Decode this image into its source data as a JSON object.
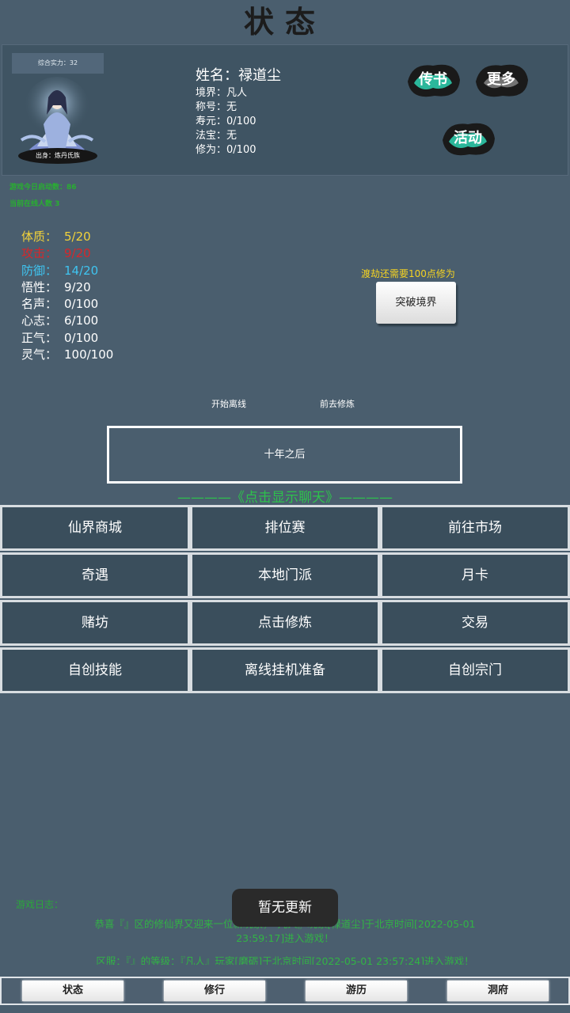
{
  "header": {
    "title": "状态"
  },
  "profile": {
    "power": "综合实力：32",
    "origin": "出身：炼丹氏族",
    "name_label": "姓名：",
    "name": "禄道尘",
    "rows": [
      {
        "label": "境界：",
        "value": "凡人"
      },
      {
        "label": "称号：",
        "value": "无"
      },
      {
        "label": "寿元：",
        "value": "0/100"
      },
      {
        "label": "法宝：",
        "value": "无"
      },
      {
        "label": "修为：",
        "value": "0/100"
      }
    ],
    "buttons": {
      "book": "传书",
      "more": "更多",
      "event": "活动"
    }
  },
  "notices": {
    "line1": "游戏今日启动数：86",
    "line2": "当前在线人数 3"
  },
  "stats": [
    {
      "label": "体质：",
      "value": "5/20",
      "color": "#f3d33a"
    },
    {
      "label": "攻击：",
      "value": "9/20",
      "color": "#d8262a"
    },
    {
      "label": "防御：",
      "value": "14/20",
      "color": "#3fc4f0"
    },
    {
      "label": "悟性：",
      "value": "9/20",
      "color": "#ffffff"
    },
    {
      "label": "名声：",
      "value": "0/100",
      "color": "#ffffff"
    },
    {
      "label": "心志：",
      "value": "6/100",
      "color": "#ffffff"
    },
    {
      "label": "正气：",
      "value": "0/100",
      "color": "#ffffff"
    },
    {
      "label": "灵气：",
      "value": "100/100",
      "color": "#ffffff"
    }
  ],
  "breakthrough": {
    "note": "渡劫还需要100点修为",
    "button": "突破境界"
  },
  "actions": {
    "offline": "开始离线",
    "cultivate": "前去修炼",
    "ten_years": "十年之后",
    "chat_toggle": "————《点击显示聊天》————"
  },
  "menu": [
    [
      "仙界商城",
      "排位赛",
      "前往市场"
    ],
    [
      "奇遇",
      "本地门派",
      "月卡"
    ],
    [
      "赌坊",
      "点击修炼",
      "交易"
    ],
    [
      "自创技能",
      "离线挂机准备",
      "自创宗门"
    ]
  ],
  "log": {
    "title": "游戏日志：",
    "line1": "恭喜『』区的修仙界又迎来一位新玩家，",
    "line1b": "『凡人』玩家[禄道尘]于北京时间[2022-05-01",
    "line2": "23:59:17]进入游戏！",
    "line3": "区服：『』的等级：『凡人』玩家[磨砺]于北京时间[2022-05-01 23:57:24]进入游戏！"
  },
  "toast": "暂无更新",
  "tabs": [
    "状态",
    "修行",
    "游历",
    "洞府"
  ],
  "colors": {
    "bg": "#4a5e6e",
    "panel": "#3f5463",
    "green": "#2dc24c",
    "yellow": "#f5d322"
  }
}
